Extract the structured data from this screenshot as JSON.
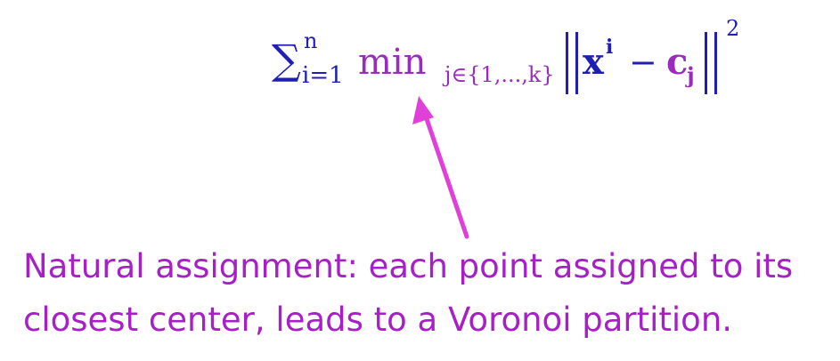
{
  "formula": {
    "sum_symbol": "∑",
    "sum_upper": "n",
    "sum_lower": "i=1",
    "min_word": "min",
    "min_subscript": "j∈{1,...,k}",
    "x_var": "x",
    "x_sup": "i",
    "minus": "−",
    "c_var": "c",
    "c_sub": "j",
    "exponent": "2"
  },
  "caption": {
    "line1": "Natural assignment: each point assigned to its",
    "line2": "closest center, leads to a Voronoi partition."
  },
  "colors": {
    "formula_blue": "#1f1fb4",
    "accent_purple": "#9a2bbf",
    "caption_purple": "#a71fc7",
    "arrow_pink": "#e040d8"
  }
}
